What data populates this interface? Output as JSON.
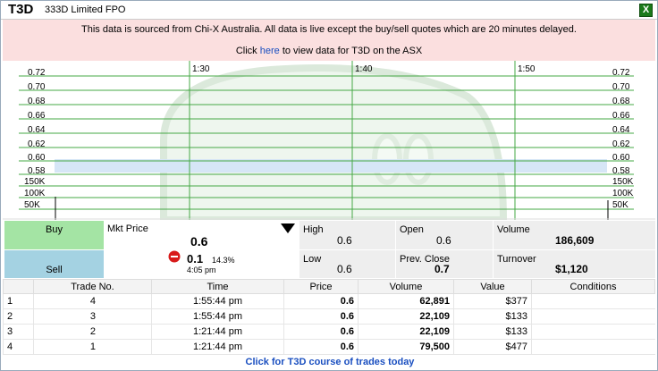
{
  "header": {
    "ticker": "T3D",
    "company": "333D Limited FPO",
    "close_label": "X"
  },
  "notice": {
    "line1": "This data is sourced from Chi-X Australia. All data is live except the buy/sell quotes which are 20 minutes delayed.",
    "line2_pre": "Click ",
    "line2_link": "here",
    "line2_post": " to view data for T3D on the ASX"
  },
  "chart_data": {
    "type": "line",
    "x_ticks": [
      "1:30",
      "1:40",
      "1:50"
    ],
    "y_ticks_price": [
      "0.72",
      "0.70",
      "0.68",
      "0.66",
      "0.64",
      "0.62",
      "0.60",
      "0.58"
    ],
    "y_ticks_volume": [
      "150K",
      "100K",
      "50K"
    ],
    "price_band": [
      0.58,
      0.6
    ],
    "grid": true
  },
  "quote": {
    "buy_label": "Buy",
    "sell_label": "Sell",
    "mkt_label": "Mkt Price",
    "mkt_value": "0.6",
    "change": "0.1",
    "change_pct": "14.3%",
    "time": "4:05 pm",
    "high_label": "High",
    "high": "0.6",
    "open_label": "Open",
    "open": "0.6",
    "volume_label": "Volume",
    "volume": "186,609",
    "low_label": "Low",
    "low": "0.6",
    "prev_close_label": "Prev. Close",
    "prev_close": "0.7",
    "turnover_label": "Turnover",
    "turnover": "$1,120"
  },
  "trades": {
    "columns": [
      "",
      "Trade No.",
      "Time",
      "Price",
      "Volume",
      "Value",
      "Conditions"
    ],
    "rows": [
      [
        "1",
        "4",
        "1:55:44 pm",
        "0.6",
        "62,891",
        "$377",
        ""
      ],
      [
        "2",
        "3",
        "1:55:44 pm",
        "0.6",
        "22,109",
        "$133",
        ""
      ],
      [
        "3",
        "2",
        "1:21:44 pm",
        "0.6",
        "22,109",
        "$133",
        ""
      ],
      [
        "4",
        "1",
        "1:21:44 pm",
        "0.6",
        "79,500",
        "$477",
        ""
      ]
    ],
    "footer_link": "Click for T3D course of trades today"
  },
  "colors": {
    "buy_bg": "#a4e4a4",
    "sell_bg": "#a4d2e2",
    "grid": "#46a846",
    "band": "#d6e6f6",
    "down_icon": "#d81b1b"
  }
}
